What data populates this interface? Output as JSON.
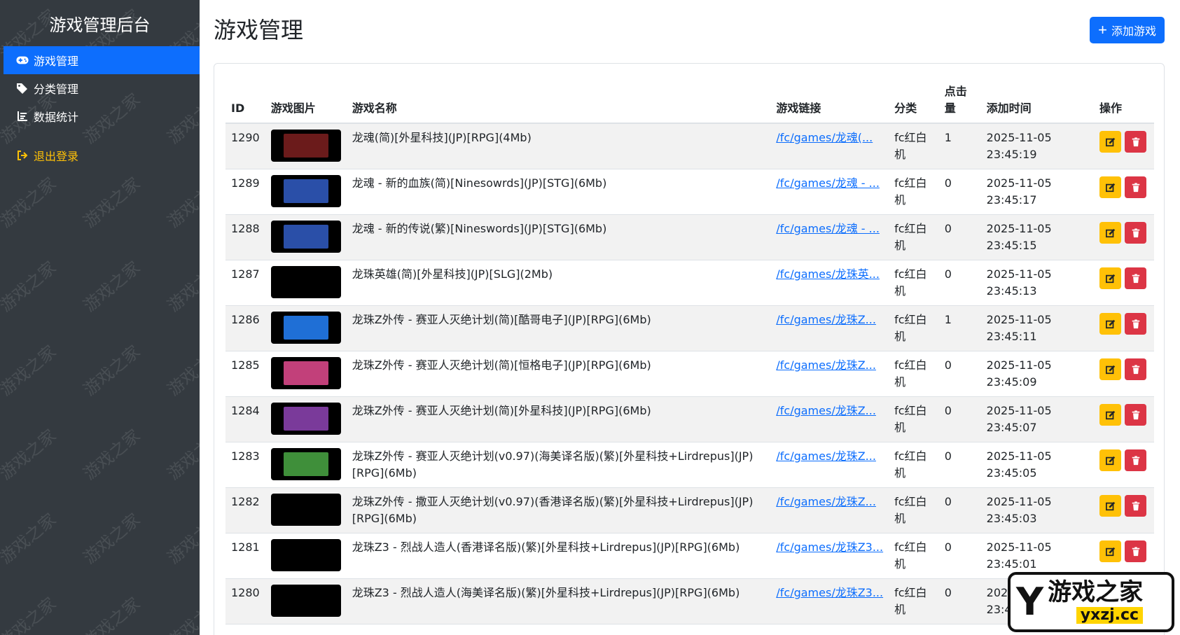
{
  "sidebar": {
    "brand": "游戏管理后台",
    "watermark_text": "游戏之家",
    "items": [
      {
        "label": "游戏管理",
        "icon": "gamepad-icon",
        "active": true
      },
      {
        "label": "分类管理",
        "icon": "tags-icon",
        "active": false
      },
      {
        "label": "数据统计",
        "icon": "chart-list-icon",
        "active": false
      }
    ],
    "logout_label": "退出登录"
  },
  "header": {
    "title": "游戏管理",
    "add_button_label": "添加游戏"
  },
  "table": {
    "columns": [
      "ID",
      "游戏图片",
      "游戏名称",
      "游戏链接",
      "分类",
      "点击量",
      "添加时间",
      "操作"
    ],
    "rows": [
      {
        "id": "1290",
        "name": "龙魂(简)[外星科技](JP)[RPG](4Mb)",
        "link": "/fc/games/龙魂(...",
        "category": "fc红白机",
        "clicks": "1",
        "time": "2025-11-05 23:45:19",
        "thumb": "#6b1b1b"
      },
      {
        "id": "1289",
        "name": "龙魂 - 新的血族(简)[Ninesowrds](JP)[STG](6Mb)",
        "link": "/fc/games/龙魂 - ...",
        "category": "fc红白机",
        "clicks": "0",
        "time": "2025-11-05 23:45:17",
        "thumb": "#2a4fa8"
      },
      {
        "id": "1288",
        "name": "龙魂 - 新的传说(繁)[Nineswords](JP)[STG](6Mb)",
        "link": "/fc/games/龙魂 - ...",
        "category": "fc红白机",
        "clicks": "0",
        "time": "2025-11-05 23:45:15",
        "thumb": "#2a4fa8"
      },
      {
        "id": "1287",
        "name": "龙珠英雄(简)[外星科技](JP)[SLG](2Mb)",
        "link": "/fc/games/龙珠英...",
        "category": "fc红白机",
        "clicks": "0",
        "time": "2025-11-05 23:45:13",
        "thumb": "#000000"
      },
      {
        "id": "1286",
        "name": "龙珠Z外传 - 赛亚人灭绝计划(简)[酷哥电子](JP)[RPG](6Mb)",
        "link": "/fc/games/龙珠Z...",
        "category": "fc红白机",
        "clicks": "1",
        "time": "2025-11-05 23:45:11",
        "thumb": "#1f6fd6"
      },
      {
        "id": "1285",
        "name": "龙珠Z外传 - 赛亚人灭绝计划(简)[恒格电子](JP)[RPG](6Mb)",
        "link": "/fc/games/龙珠Z...",
        "category": "fc红白机",
        "clicks": "0",
        "time": "2025-11-05 23:45:09",
        "thumb": "#c2407a"
      },
      {
        "id": "1284",
        "name": "龙珠Z外传 - 赛亚人灭绝计划(简)[外星科技](JP)[RPG](6Mb)",
        "link": "/fc/games/龙珠Z...",
        "category": "fc红白机",
        "clicks": "0",
        "time": "2025-11-05 23:45:07",
        "thumb": "#7a3a9a"
      },
      {
        "id": "1283",
        "name": "龙珠Z外传 - 赛亚人灭绝计划(v0.97)(海美译名版)(繁)[外星科技+Lirdrepus](JP)[RPG](6Mb)",
        "link": "/fc/games/龙珠Z...",
        "category": "fc红白机",
        "clicks": "0",
        "time": "2025-11-05 23:45:05",
        "thumb": "#3f8f3a"
      },
      {
        "id": "1282",
        "name": "龙珠Z外传 - 撒亚人灭绝计划(v0.97)(香港译名版)(繁)[外星科技+Lirdrepus](JP)[RPG](6Mb)",
        "link": "/fc/games/龙珠Z...",
        "category": "fc红白机",
        "clicks": "0",
        "time": "2025-11-05 23:45:03",
        "thumb": "#000000"
      },
      {
        "id": "1281",
        "name": "龙珠Z3 - 烈战人造人(香港译名版)(繁)[外星科技+Lirdrepus](JP)[RPG](6Mb)",
        "link": "/fc/games/龙珠Z3...",
        "category": "fc红白机",
        "clicks": "0",
        "time": "2025-11-05 23:45:01",
        "thumb": "#000000"
      },
      {
        "id": "1280",
        "name": "龙珠Z3 - 烈战人造人(海美译名版)(繁)[外星科技+Lirdrepus](JP)[RPG](6Mb)",
        "link": "/fc/games/龙珠Z3...",
        "category": "fc红白机",
        "clicks": "0",
        "time": "2025-11-05 23:45:00",
        "thumb": "#000000"
      }
    ]
  },
  "site_logo": {
    "mark": "Y",
    "cn": "游戏之家",
    "en": "yxzj.cc"
  },
  "colors": {
    "sidebar_bg": "#343a40",
    "primary": "#0d6efd",
    "warning": "#ffc107",
    "danger": "#dc3545"
  }
}
